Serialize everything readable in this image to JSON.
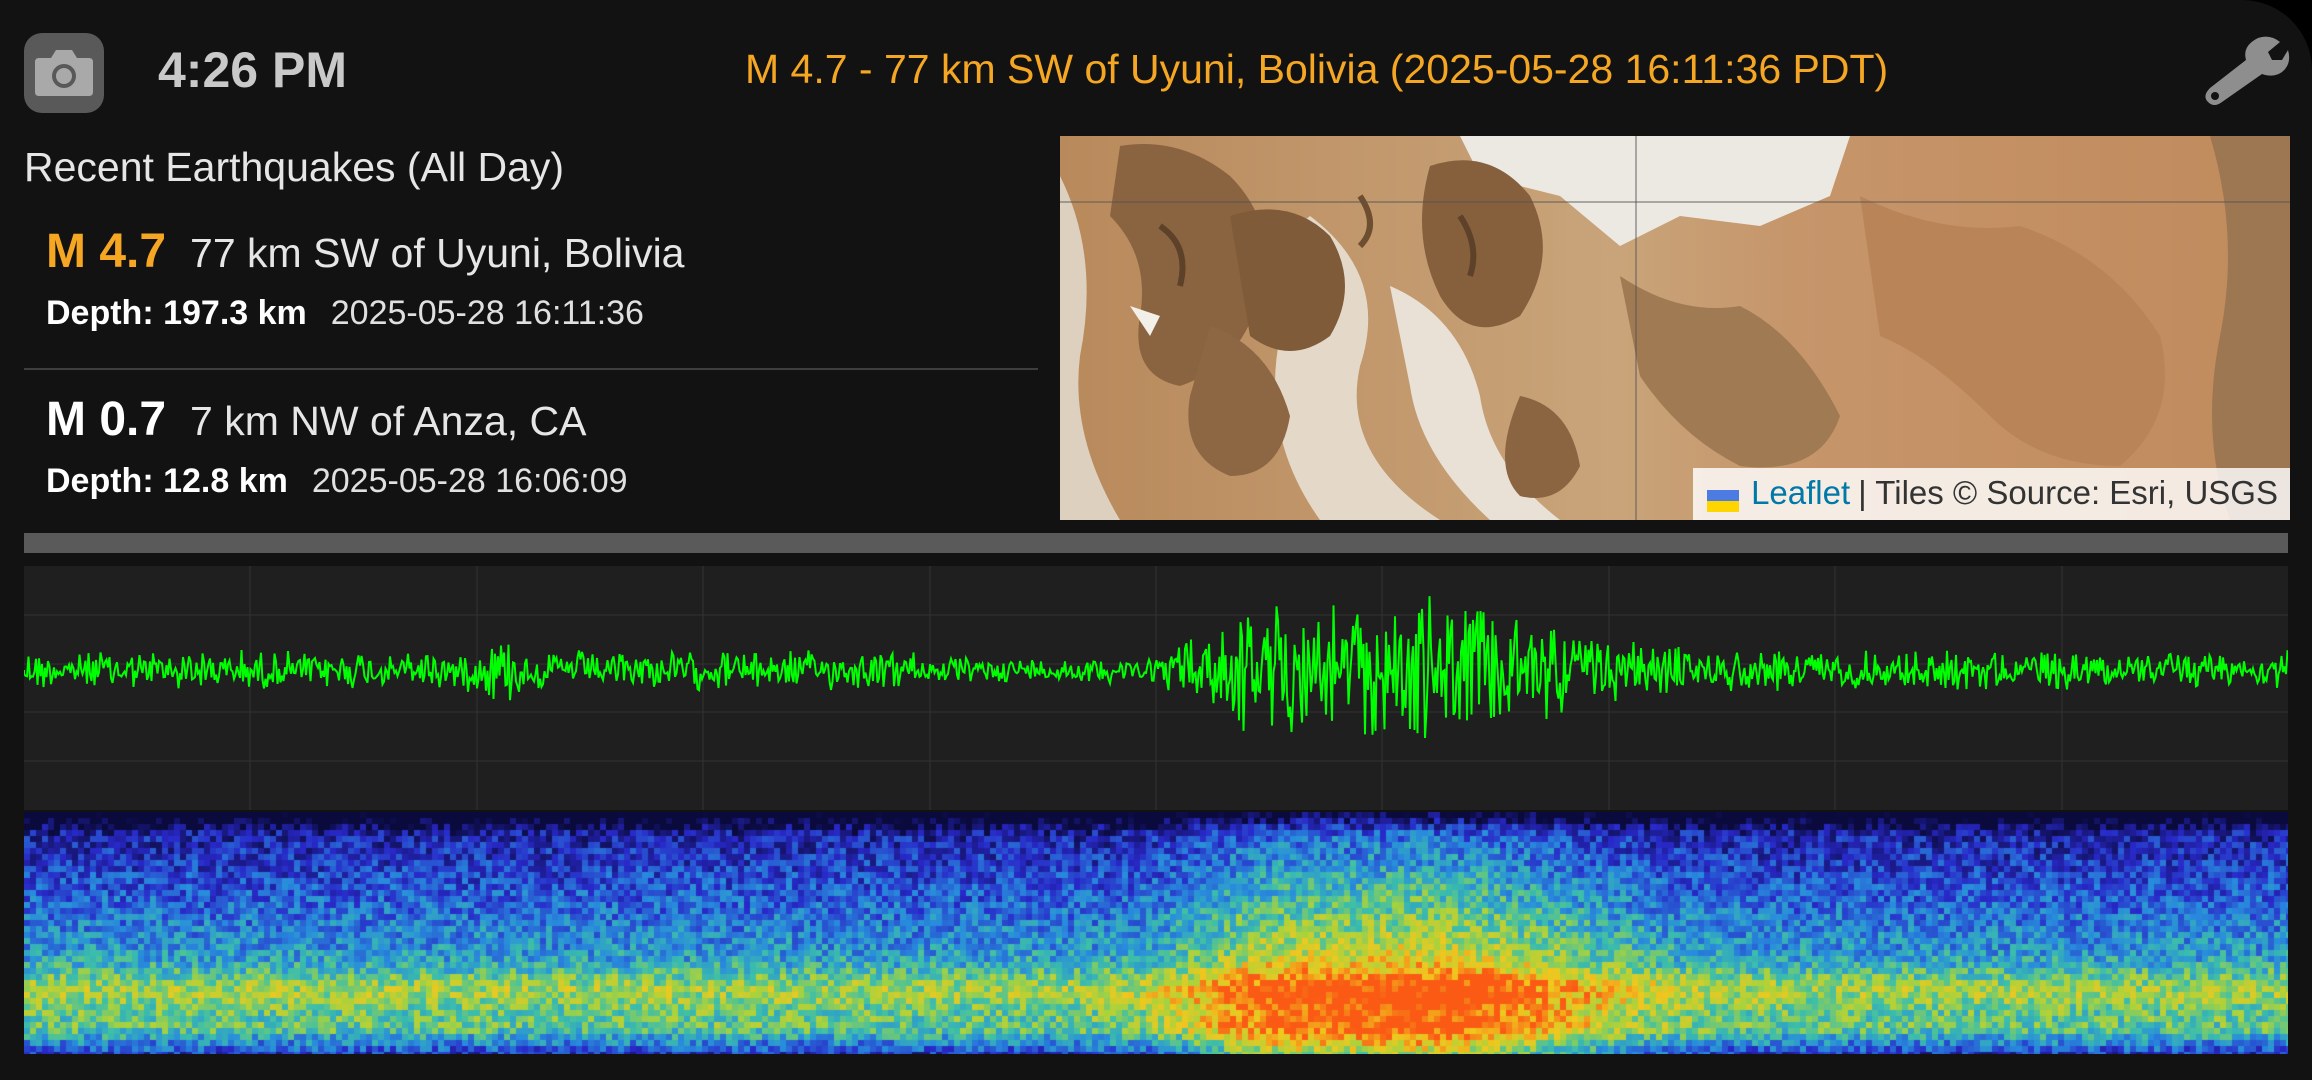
{
  "status": {
    "time": "4:26 PM"
  },
  "header": {
    "event_title": "M 4.7 - 77 km SW of Uyuni, Bolivia (2025-05-28 16:11:36 PDT)",
    "camera_icon": "camera-icon",
    "settings_icon": "wrench-icon"
  },
  "recent": {
    "title": "Recent Earthquakes (All Day)",
    "quakes": [
      {
        "magnitude": "M 4.7",
        "place": "77 km SW of Uyuni, Bolivia",
        "depth": "Depth: 197.3 km",
        "time": "2025-05-28 16:11:36"
      },
      {
        "magnitude": "M 0.7",
        "place": "7 km NW of Anza, CA",
        "depth": "Depth: 12.8 km",
        "time": "2025-05-28 16:06:09"
      }
    ]
  },
  "map": {
    "attribution_link": "Leaflet",
    "attribution_text": "| Tiles © Source: Esri, USGS"
  },
  "colors": {
    "accent": "#f5a623",
    "waveform": "#00ff00",
    "background": "#121212",
    "link": "#0078a8"
  }
}
